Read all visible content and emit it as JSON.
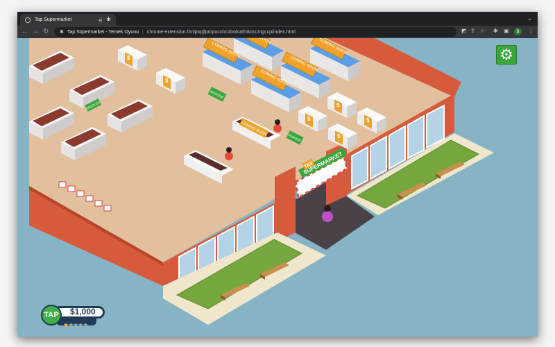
{
  "browser": {
    "tab_title": "Tap Supermarket",
    "new_tab": "+",
    "page_title": "Tap Süpermarket - Yemek Oyunu",
    "url": "chrome-extension://mlpopjfpmpocnhcdoolnafmkoccmgccp/index.html",
    "profile_initial": "b"
  },
  "game": {
    "signs": {
      "coming_soon": "COMING SOON",
      "machine": "MACHINE",
      "fashion": "FASHION",
      "produce": "PRODUCE",
      "price": "$"
    },
    "storefront": {
      "tap": "TAP",
      "name": "SUPERMARKET"
    },
    "hud": {
      "logo": "TAP",
      "money": "$1,000",
      "rating": 1,
      "rating_max": 5,
      "star_glyph": "★"
    }
  },
  "colors": {
    "floor": "#e2c09e",
    "wall": "#d65b3c",
    "sky": "#87b4c5",
    "accent_green": "#3aa63c",
    "sign_orange": "#f0a22a"
  }
}
